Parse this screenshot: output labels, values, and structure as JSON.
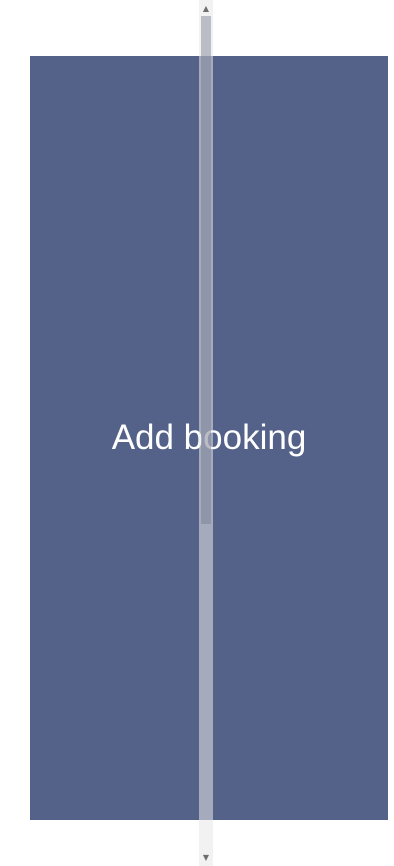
{
  "main": {
    "button_label": "Add booking"
  },
  "scrollbar": {
    "up_arrow_icon": "triangle-up-icon",
    "down_arrow_icon": "triangle-down-icon"
  },
  "colors": {
    "button_background": "#54628a",
    "button_text": "#ffffff",
    "page_background": "#ffffff"
  }
}
